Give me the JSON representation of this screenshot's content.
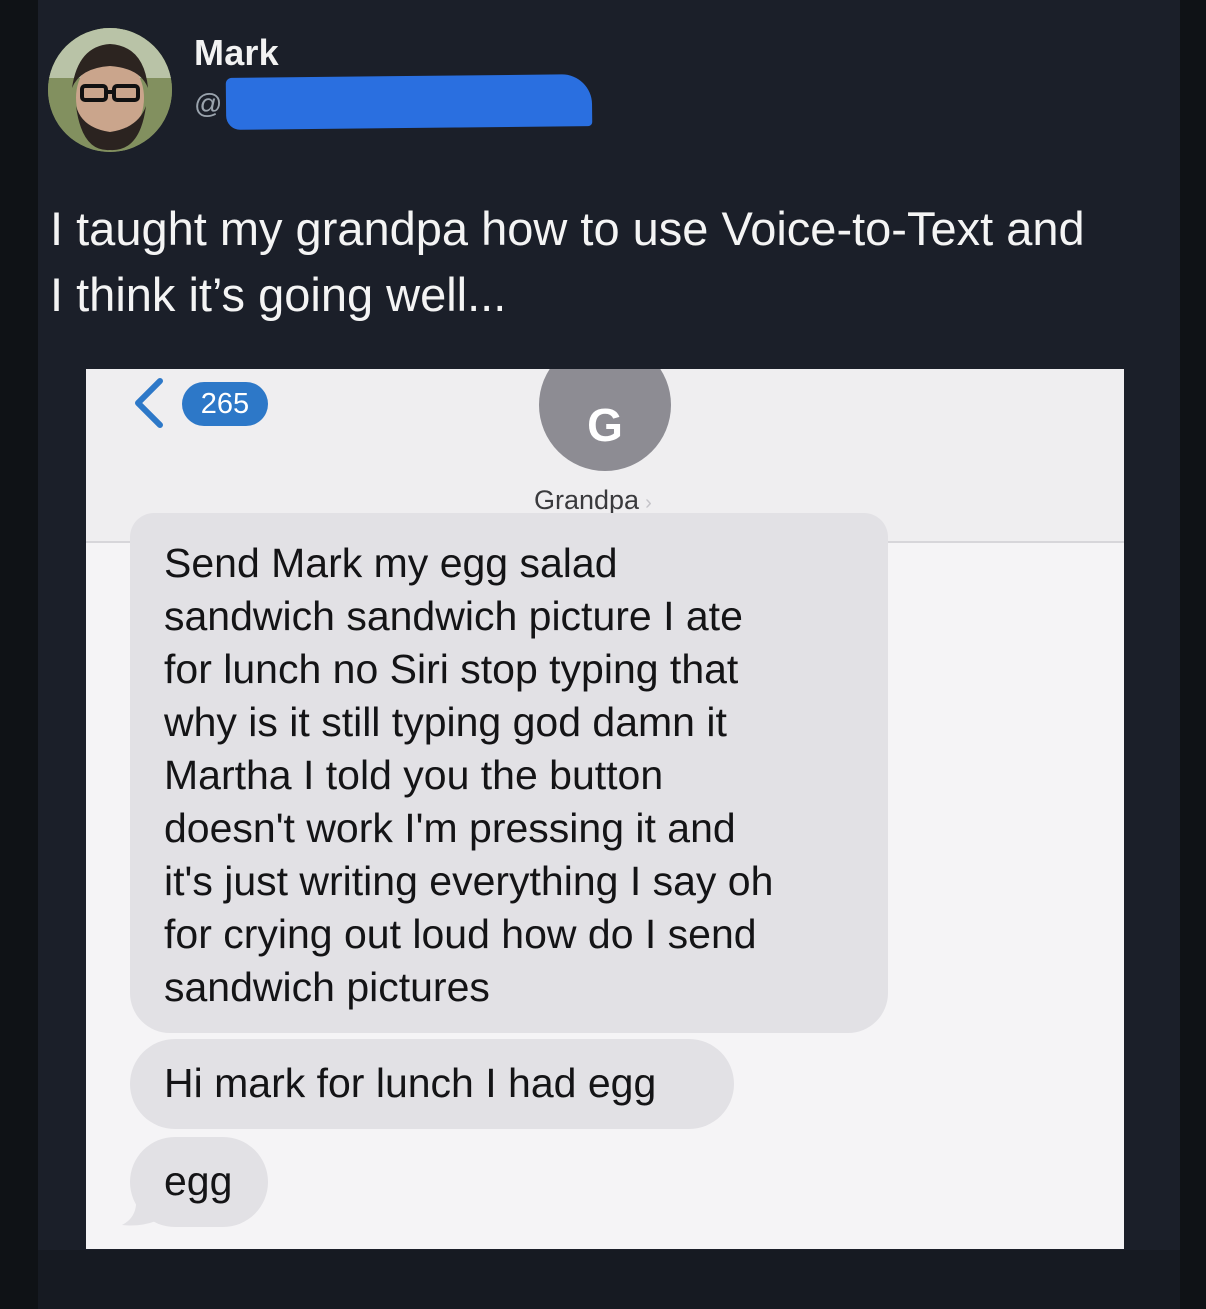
{
  "post": {
    "author_name": "Mark",
    "handle_prefix": "@",
    "text_lines": [
      "I taught my grandpa how to use Voice-to-Text and",
      "I think it’s going well..."
    ]
  },
  "screenshot": {
    "back_icon": "chevron-left-icon",
    "unread_count": "265",
    "contact_initial": "G",
    "contact_name": "Grandpa",
    "contact_chevron": "›",
    "messages": [
      {
        "lines": [
          "Send Mark my egg salad",
          "sandwich sandwich picture I ate",
          "for lunch no Siri stop typing that",
          "why is it still typing god damn it",
          "Martha I told you the button",
          "doesn't work I'm pressing it and",
          "it's just writing everything I say oh",
          "for crying out loud how do I send",
          "sandwich pictures"
        ]
      },
      {
        "lines": [
          "Hi mark for lunch I had egg"
        ]
      },
      {
        "lines": [
          "egg"
        ]
      }
    ]
  },
  "colors": {
    "page_bg": "#1b1f29",
    "handle_redaction": "#2a6fe0",
    "badge": "#2d78c8",
    "bubble": "#e2e1e5",
    "contact_avatar": "#8d8c93"
  }
}
